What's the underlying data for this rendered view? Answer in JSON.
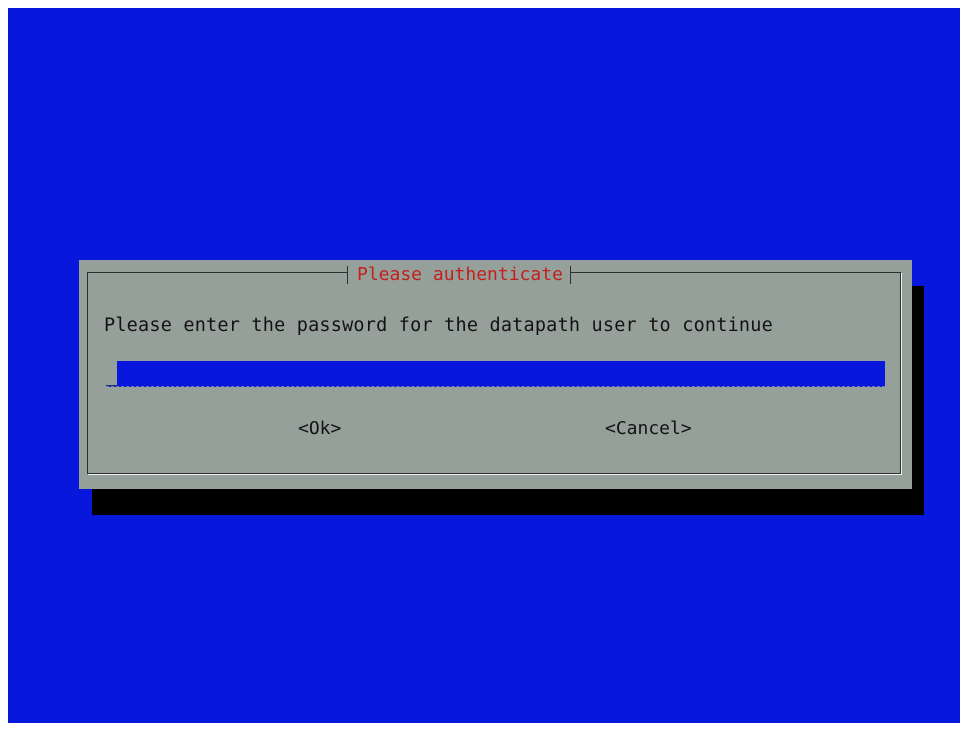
{
  "colors": {
    "screen_background": "#0817dc",
    "dialog_background": "#96a09b",
    "title_text": "#c31f1c",
    "shadow": "#000000"
  },
  "dialog": {
    "title": "Please authenticate",
    "prompt": "Please enter the password for the datapath user to continue",
    "password_value": ""
  },
  "buttons": {
    "ok_label": "<Ok>",
    "cancel_label": "<Cancel>"
  }
}
